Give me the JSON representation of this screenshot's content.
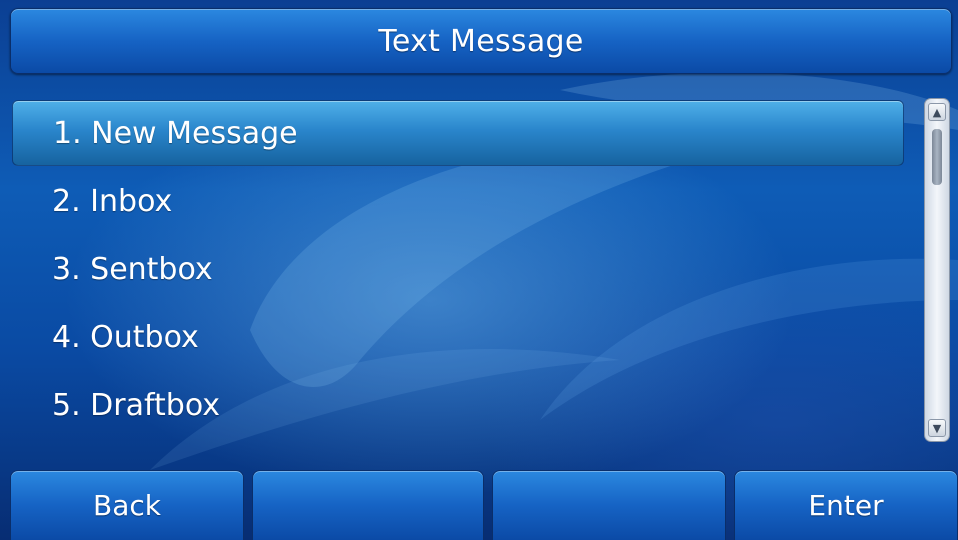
{
  "header": {
    "title": "Text Message"
  },
  "menu": {
    "items": [
      {
        "label": "1. New Message",
        "selected": true
      },
      {
        "label": "2. Inbox",
        "selected": false
      },
      {
        "label": "3. Sentbox",
        "selected": false
      },
      {
        "label": "4. Outbox",
        "selected": false
      },
      {
        "label": "5. Draftbox",
        "selected": false
      }
    ]
  },
  "scrollbar": {
    "up_icon": "▲",
    "down_icon": "▼"
  },
  "softkeys": [
    {
      "label": "Back"
    },
    {
      "label": ""
    },
    {
      "label": ""
    },
    {
      "label": "Enter"
    }
  ],
  "colors": {
    "background": "#0e5cb6",
    "title_bar": "#1663c4",
    "selection": "#2a86cc",
    "text": "#ffffff"
  }
}
